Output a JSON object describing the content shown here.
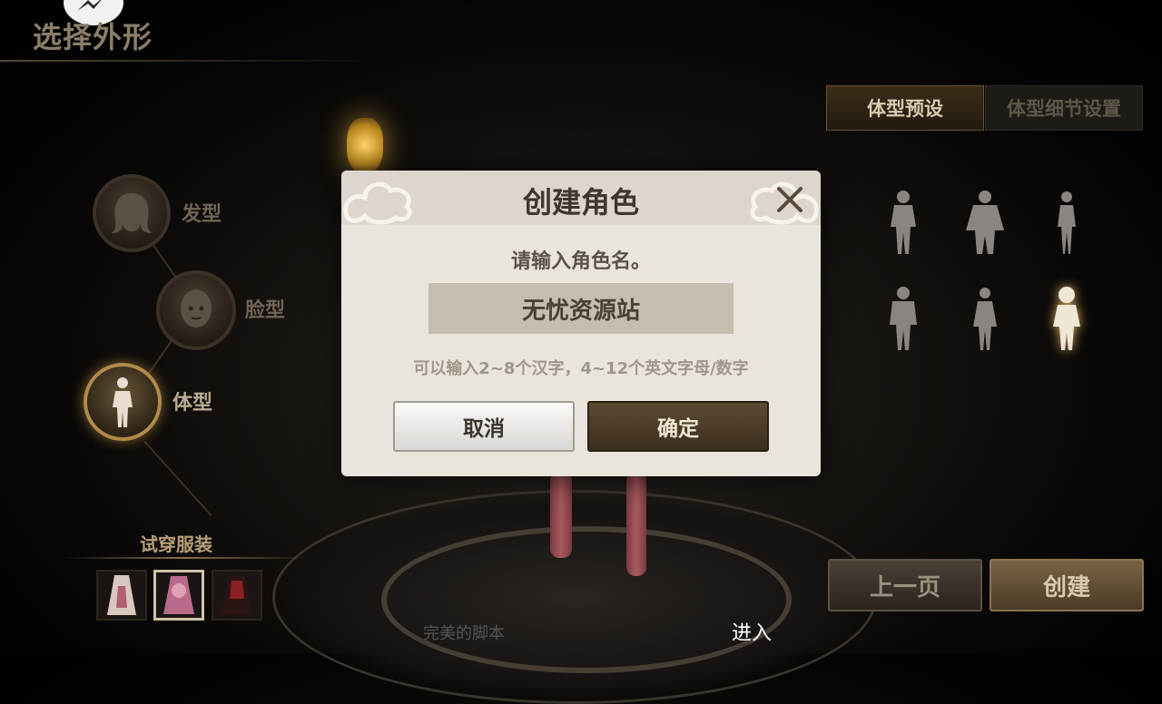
{
  "header": {
    "title": "选择外形"
  },
  "categories": [
    {
      "label": "发型",
      "icon": "hair-icon"
    },
    {
      "label": "脸型",
      "icon": "face-icon"
    },
    {
      "label": "体型",
      "icon": "body-icon",
      "active": true
    }
  ],
  "outfits": {
    "title": "试穿服装",
    "items": [
      "outfit-white-dress",
      "outfit-pink-dress",
      "outfit-red-black-dress"
    ],
    "selected_index": 1
  },
  "body_panel": {
    "tabs": [
      {
        "label": "体型预设",
        "active": true
      },
      {
        "label": "体型细节设置",
        "active": false
      }
    ],
    "presets_selected_index": 5
  },
  "nav": {
    "prev_label": "上一页",
    "create_label": "创建"
  },
  "bottom": {
    "left_text": "完美的脚本",
    "enter_label": "进入"
  },
  "dialog": {
    "title": "创建角色",
    "prompt": "请输入角色名。",
    "name_value": "无忧资源站",
    "hint": "可以输入2~8个汉字，4~12个英文字母/数字",
    "cancel_label": "取消",
    "confirm_label": "确定",
    "close_icon": "close-icon"
  },
  "colors": {
    "accent_gold": "#b08a4a",
    "dialog_bg": "#e9e4dc",
    "confirm_bg": "#4a3a26"
  }
}
